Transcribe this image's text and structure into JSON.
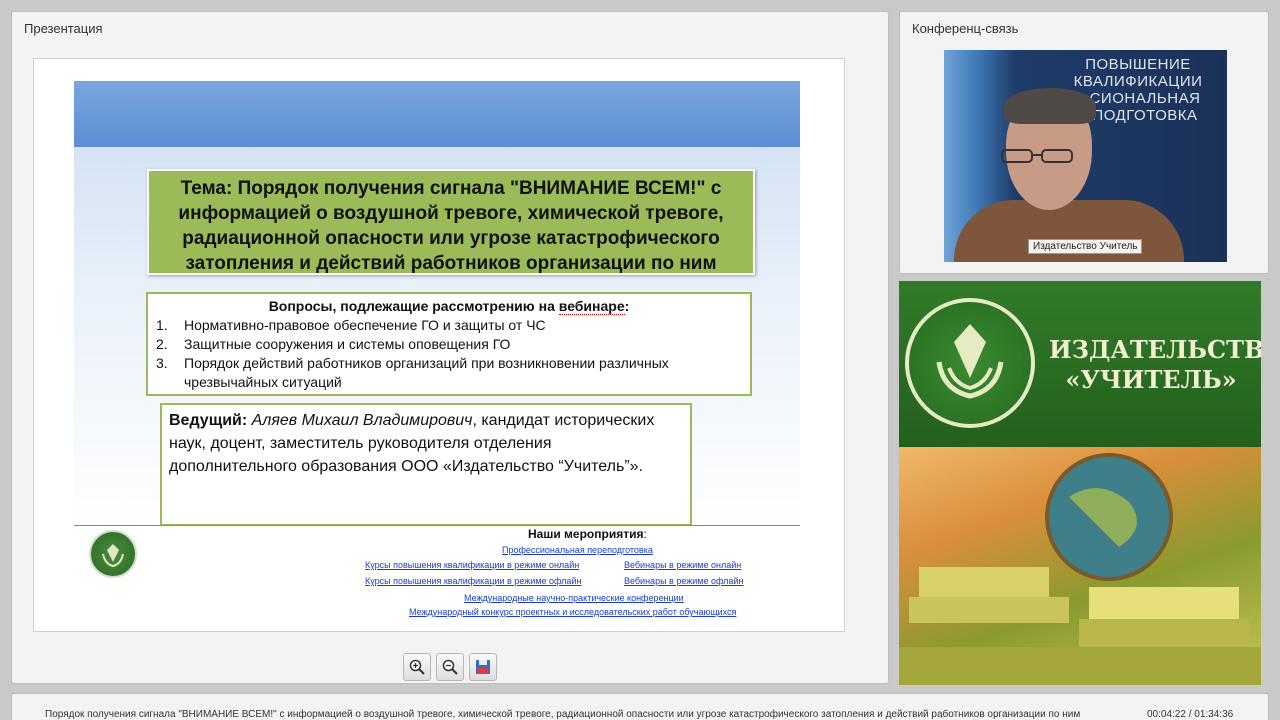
{
  "presentation_panel": {
    "title": "Презентация"
  },
  "conference_panel": {
    "title": "Конференц-связь"
  },
  "slide": {
    "topic": "Тема: Порядок получения сигнала \"ВНИМАНИЕ ВСЕМ!\" с информацией о воздушной тревоге, химической тревоге, радиационной опасности или угрозе катастрофического затопления и действий работников организации по ним",
    "questions_heading_prefix": "Вопросы, подлежащие рассмотрению на ",
    "questions_heading_word": "вебинаре",
    "questions_heading_suffix": ":",
    "questions": [
      {
        "num": "1.",
        "text": "Нормативно-правовое обеспечение ГО и защиты от ЧС"
      },
      {
        "num": "2.",
        "text": "Защитные сооружения и системы оповещения ГО"
      },
      {
        "num": "3.",
        "text": "Порядок действий работников организаций при возникновении различных чрезвычайных ситуаций"
      }
    ],
    "host_label": "Ведущий:",
    "host_name": "Аляев Михаил Владимирович",
    "host_description": ", кандидат исторических наук, доцент, заместитель руководителя отделения дополнительного образования ООО «Издательство “Учитель”».",
    "events_title": "Наши мероприятия",
    "events_title_suffix": ":",
    "events": {
      "retraining": "Профессиональная переподготовка",
      "courses_online": "Курсы повышения квалификации в режиме онлайн",
      "webinars_online": "Вебинары в режиме онлайн",
      "courses_offline": "Курсы повышения квалификации в режиме офлайн",
      "webinars_offline": "Вебинары в режиме офлайн",
      "conferences": "Международные научно-практические конференции",
      "contest": "Международный конкурс проектных и исследовательских работ обучающихся"
    }
  },
  "toolbar": {
    "zoom_in_icon": "zoom-in-icon",
    "zoom_out_icon": "zoom-out-icon",
    "save_icon": "floppy-disk-icon"
  },
  "webcam": {
    "background_text": "ПОВЫШЕНИЕ КВАЛИФИКАЦИИ ...СИОНАЛЬНАЯ ...ПОДГОТОВКА",
    "label": "Издательство Учитель"
  },
  "banner": {
    "title_line1": "ИЗДАТЕЛЬСТВО",
    "title_line2": "«УЧИТЕЛЬ»"
  },
  "footer": {
    "title": "Порядок получения сигнала \"ВНИМАНИЕ ВСЕМ!\" с информацией о воздушной тревоге, химической тревоге, радиационной опасности или угрозе катастрофического затопления и действий работников организации по ним",
    "time": "00:04:22 / 01:34:36"
  },
  "colors": {
    "topic_box": "#9bbb59",
    "slide_header": "#5b8ed6",
    "banner_green": "#2f6e28",
    "link": "#1a3bd6"
  }
}
